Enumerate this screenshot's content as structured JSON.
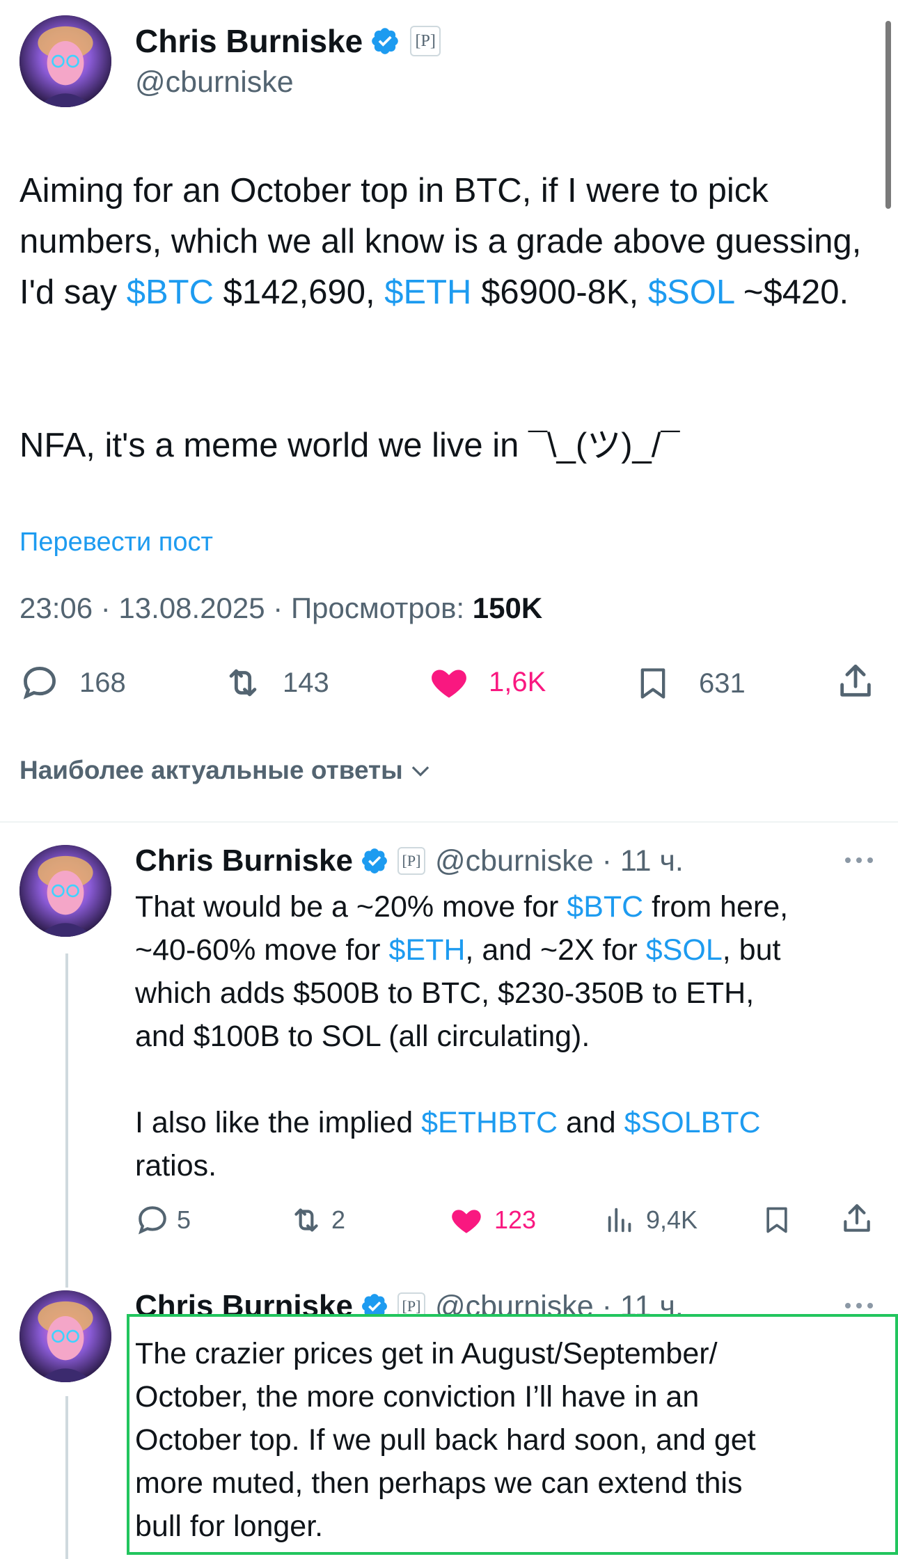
{
  "main_post": {
    "author_name": "Chris Burniske",
    "affiliate_badge": "P",
    "handle": "@cburniske",
    "text_segments": [
      "Aiming for an October top in BTC, if I were to pick numbers, which we all know is a grade above guessing, I'd say ",
      "$BTC",
      " $142,690, ",
      "$ETH",
      " $6900-8K, ",
      "$SOL",
      " ~$420."
    ],
    "text_line2": "NFA, it's a meme world we live in ¯\\_(ツ)_/¯",
    "translate_link": "Перевести пост",
    "timestamp": "23:06 · 13.08.2025 · Просмотров: ",
    "views": "150K",
    "actions": {
      "replies": "168",
      "reposts": "143",
      "likes": "1,6K",
      "bookmarks": "631"
    }
  },
  "sort_label": "Наиболее актуальные ответы",
  "replies": [
    {
      "author_name": "Chris Burniske",
      "affiliate_badge": "P",
      "handle_time": "@cburniske · 11 ч.",
      "text": {
        "l1a": "That would be a ~20% move for ",
        "l1b": "$BTC",
        "l1c": " from here,",
        "l2a": "~40-60% move for ",
        "l2b": "$ETH",
        "l2c": ", and ~2X for ",
        "l2d": "$SOL",
        "l2e": ", but",
        "l3": "which adds $500B to BTC, $230-350B to ETH,",
        "l4": "and $100B to SOL (all circulating).",
        "l5a": "I also like the implied ",
        "l5b": "$ETHBTC",
        "l5c": " and ",
        "l5d": "$SOLBTC",
        "l6": "ratios."
      },
      "actions": {
        "replies": "5",
        "reposts": "2",
        "likes": "123",
        "views": "9,4K"
      }
    },
    {
      "author_name": "Chris Burniske",
      "affiliate_badge": "P",
      "handle_time": "@cburniske · 11 ч.",
      "text_lines": [
        "The crazier prices get in August/September/",
        "October, the more conviction I’ll have in an",
        "October top. If we pull back hard soon, and get",
        "more muted, then perhaps we can extend this",
        "bull for longer."
      ]
    }
  ],
  "colors": {
    "link": "#1d9bf0",
    "like": "#f91880",
    "verified": "#1d9bf0",
    "highlight": "#22c55e"
  },
  "icons": [
    "verified-badge-icon",
    "reply-icon",
    "repost-icon",
    "heart-icon",
    "bookmark-icon",
    "share-icon",
    "views-icon",
    "more-icon",
    "chevron-down-icon"
  ]
}
